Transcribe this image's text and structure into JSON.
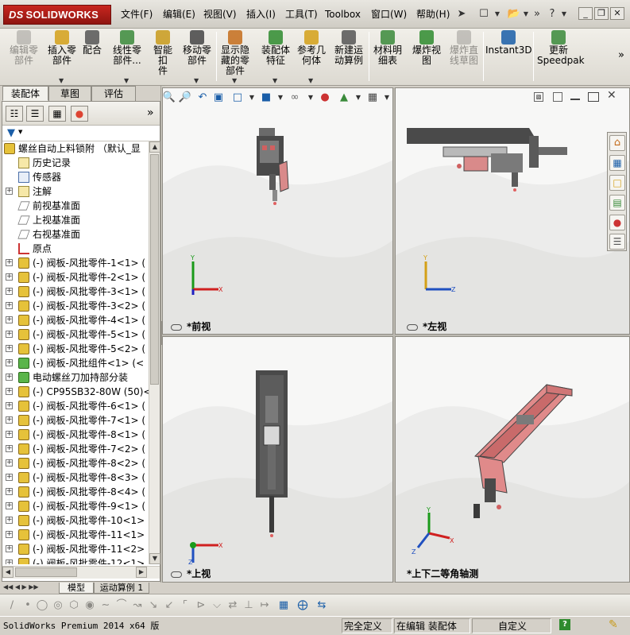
{
  "app": {
    "brand": "SOLIDWORKS",
    "brand_prefix": "DS"
  },
  "menu": [
    "文件(F)",
    "编辑(E)",
    "视图(V)",
    "插入(I)",
    "工具(T)",
    "Toolbox",
    "窗口(W)",
    "帮助(H)"
  ],
  "command_manager": [
    {
      "label": "编辑零\n部件",
      "icon": "edit-component-icon",
      "enabled": false
    },
    {
      "label": "插入零\n部件",
      "icon": "insert-component-icon",
      "enabled": true
    },
    {
      "label": "配合",
      "icon": "mate-icon",
      "enabled": true
    },
    {
      "label": "线性零\n部件...",
      "icon": "linear-pattern-icon",
      "enabled": true
    },
    {
      "label": "智能扣\n件",
      "icon": "smart-fasteners-icon",
      "enabled": true
    },
    {
      "label": "移动零\n部件",
      "icon": "move-component-icon",
      "enabled": true
    },
    {
      "label": "显示隐\n藏的零\n部件",
      "icon": "show-hidden-icon",
      "enabled": true
    },
    {
      "label": "装配体\n特征",
      "icon": "assembly-features-icon",
      "enabled": true
    },
    {
      "label": "参考几\n何体",
      "icon": "reference-geometry-icon",
      "enabled": true
    },
    {
      "label": "新建运\n动算例",
      "icon": "new-motion-study-icon",
      "enabled": true
    },
    {
      "label": "材料明\n细表",
      "icon": "bom-icon",
      "enabled": true
    },
    {
      "label": "爆炸视\n图",
      "icon": "exploded-view-icon",
      "enabled": true
    },
    {
      "label": "爆炸直\n线草图",
      "icon": "explode-line-sketch-icon",
      "enabled": false
    },
    {
      "label": "Instant3D",
      "icon": "instant3d-icon",
      "enabled": true
    },
    {
      "label": "更新\nSpeedpak",
      "icon": "speedpak-icon",
      "enabled": true
    }
  ],
  "feature_tabs": [
    "装配体",
    "草图",
    "评估"
  ],
  "tree": {
    "root": "螺丝自动上料锁附 （默认_显",
    "items": [
      {
        "label": "历史记录",
        "icon": "history-icon",
        "expand": false
      },
      {
        "label": "传感器",
        "icon": "sensor-icon",
        "expand": false
      },
      {
        "label": "注解",
        "icon": "annotation-icon",
        "expand": true
      },
      {
        "label": "前视基准面",
        "icon": "plane-icon",
        "expand": false
      },
      {
        "label": "上视基准面",
        "icon": "plane-icon",
        "expand": false
      },
      {
        "label": "右视基准面",
        "icon": "plane-icon",
        "expand": false
      },
      {
        "label": "原点",
        "icon": "origin-icon",
        "expand": false
      },
      {
        "label": "(-) 阀板-风批零件-1<1> (",
        "icon": "part-icon",
        "expand": true
      },
      {
        "label": "(-) 阀板-风批零件-2<1> (",
        "icon": "part-icon",
        "expand": true
      },
      {
        "label": "(-) 阀板-风批零件-3<1> (",
        "icon": "part-icon",
        "expand": true
      },
      {
        "label": "(-) 阀板-风批零件-3<2> (",
        "icon": "part-icon",
        "expand": true
      },
      {
        "label": "(-) 阀板-风批零件-4<1> (",
        "icon": "part-icon",
        "expand": true
      },
      {
        "label": "(-) 阀板-风批零件-5<1> (",
        "icon": "part-icon",
        "expand": true
      },
      {
        "label": "(-) 阀板-风批零件-5<2> (",
        "icon": "part-icon",
        "expand": true
      },
      {
        "label": "(-) 阀板-风批组件<1> (<",
        "icon": "subassembly-icon",
        "expand": true
      },
      {
        "label": "电动螺丝刀加持部分装",
        "icon": "subassembly-icon",
        "expand": true
      },
      {
        "label": "(-) CP95SB32-80W (50)<1>",
        "icon": "part-icon",
        "expand": true
      },
      {
        "label": "(-) 阀板-风批零件-6<1> (",
        "icon": "part-icon",
        "expand": true
      },
      {
        "label": "(-) 阀板-风批零件-7<1> (",
        "icon": "part-icon",
        "expand": true
      },
      {
        "label": "(-) 阀板-风批零件-8<1> (",
        "icon": "part-icon",
        "expand": true
      },
      {
        "label": "(-) 阀板-风批零件-7<2> (",
        "icon": "part-icon",
        "expand": true
      },
      {
        "label": "(-) 阀板-风批零件-8<2> (",
        "icon": "part-icon",
        "expand": true
      },
      {
        "label": "(-) 阀板-风批零件-8<3> (",
        "icon": "part-icon",
        "expand": true
      },
      {
        "label": "(-) 阀板-风批零件-8<4> (",
        "icon": "part-icon",
        "expand": true
      },
      {
        "label": "(-) 阀板-风批零件-9<1> (",
        "icon": "part-icon",
        "expand": true
      },
      {
        "label": "(-) 阀板-风批零件-10<1>",
        "icon": "part-icon",
        "expand": true
      },
      {
        "label": "(-) 阀板-风批零件-11<1>",
        "icon": "part-icon",
        "expand": true
      },
      {
        "label": "(-) 阀板-风批零件-11<2>",
        "icon": "part-icon",
        "expand": true
      },
      {
        "label": "(-) 阀板-风批零件-12<1>",
        "icon": "part-icon",
        "expand": true
      }
    ]
  },
  "viewports": [
    {
      "label": "*前视"
    },
    {
      "label": "*左视"
    },
    {
      "label": "*上视"
    },
    {
      "label": "*上下二等角轴测"
    }
  ],
  "bottom_tabs": [
    "模型",
    "运动算例 1"
  ],
  "status": {
    "app_version": "SolidWorks Premium 2014 x64 版",
    "definition": "完全定义",
    "mode": "在编辑 装配体",
    "units": "自定义",
    "help": "?"
  },
  "colors": {
    "part_red": "#e07070",
    "body_gray": "#5a5a5a",
    "accent_blue": "#1a5ea8"
  }
}
